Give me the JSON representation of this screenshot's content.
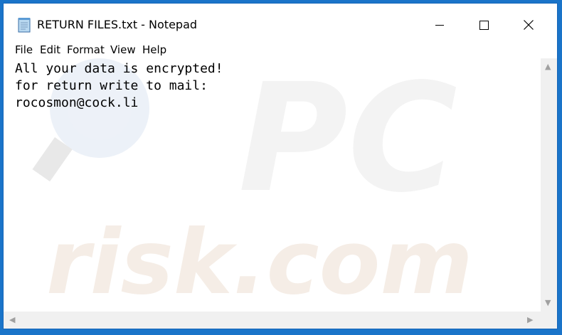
{
  "window": {
    "title": "RETURN FILES.txt - Notepad",
    "menu": [
      "File",
      "Edit",
      "Format",
      "View",
      "Help"
    ]
  },
  "editor": {
    "lines": [
      "All your data is encrypted!",
      "for return write to mail:",
      "rocosmon@cock.li"
    ]
  },
  "watermark": {
    "text": "risk.com"
  },
  "icons": {
    "app": "notepad-icon",
    "minimize": "minimize-icon",
    "maximize": "maximize-icon",
    "close": "close-icon"
  },
  "colors": {
    "desktop": "#1a74c9",
    "window_border": "#1565b8",
    "watermark": "#f2f2f2"
  }
}
